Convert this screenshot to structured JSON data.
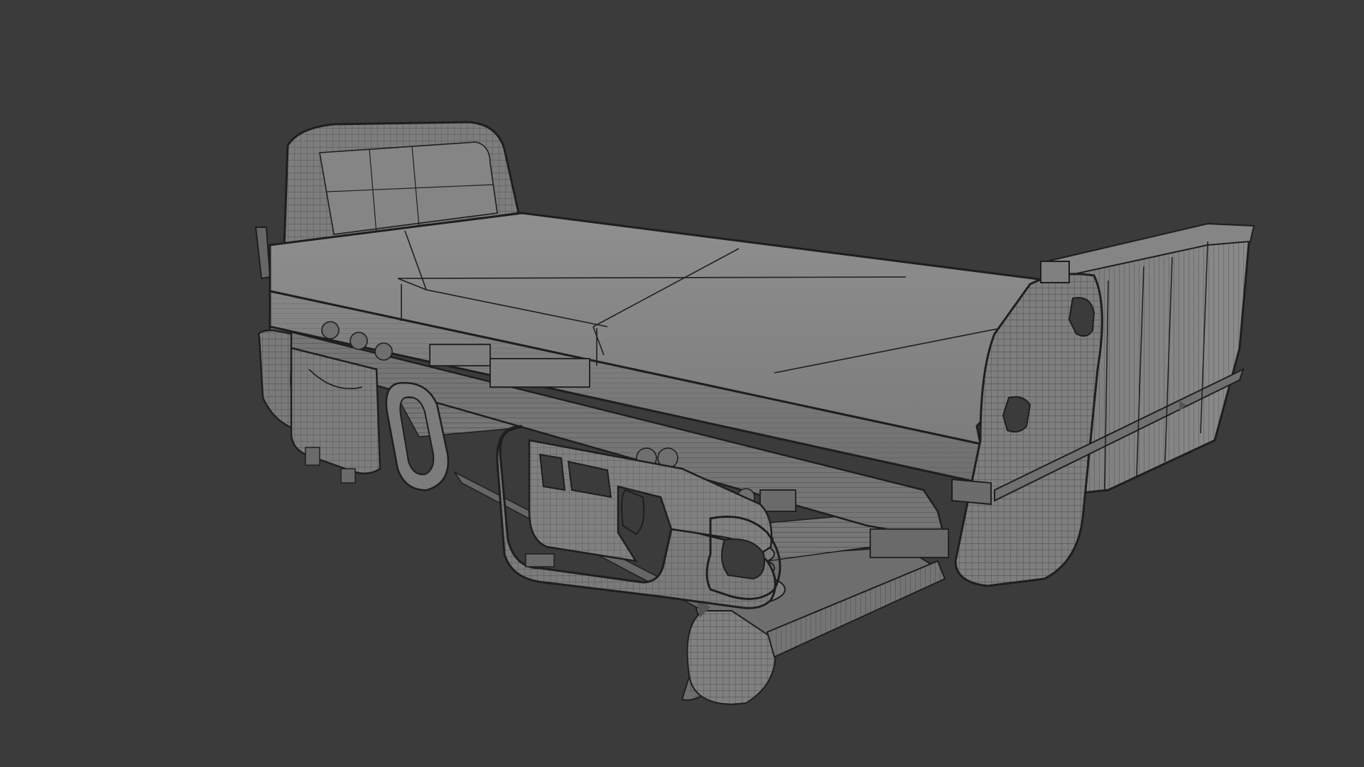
{
  "viewport": {
    "background": "#3b3b3b",
    "mesh_fill": "#8a8a8a",
    "mesh_fill_dark": "#6f6f6f",
    "mesh_fill_light": "#9a9a9a",
    "wire_color": "#1e1e1e",
    "shading": "solid-with-wireframe",
    "subject": "hospital-bed-model"
  }
}
